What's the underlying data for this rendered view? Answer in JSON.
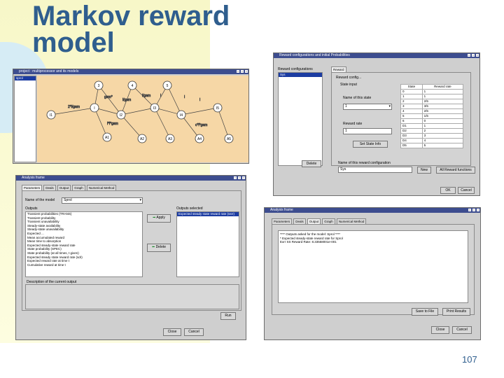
{
  "slide": {
    "title_line1": "Markov reward",
    "title_line2": "model",
    "page_number": "107"
  },
  "markov_window": {
    "title": "project : multiprocessor and its models",
    "tree_item": "sprol",
    "nodes": [
      "I1",
      "I",
      "I2",
      "I3",
      "I4",
      "I5",
      "3",
      "4",
      "5",
      "A1",
      "A2",
      "A3",
      "A4",
      "A5"
    ],
    "edge_labels": [
      "2*l/gam",
      "gam*",
      "l/gam",
      "l/gam",
      "l",
      "l",
      "l",
      "l*l*gam",
      "c*l*gam"
    ]
  },
  "reward_window": {
    "title": "Reward configurations and initial Probabilities",
    "list_header": "Reward configurations",
    "list_item": "Sys",
    "tab": "Reward",
    "group_label": "Reward config...",
    "state_label": "State input",
    "name_label": "Name of this state",
    "state_value": "1",
    "reward_rate_label": "Reward rate",
    "reward_rate_value": "1",
    "apply_button": "Set State Info",
    "table_headers": [
      "State",
      "Reward rate"
    ],
    "table_rows": [
      [
        "0",
        "1"
      ],
      [
        "1",
        "1"
      ],
      [
        "2",
        "2/5"
      ],
      [
        "3",
        "3/5"
      ],
      [
        "4",
        "2/5"
      ],
      [
        "5",
        "1/5"
      ],
      [
        "6",
        "0"
      ],
      [
        "D1",
        "1"
      ],
      [
        "D2",
        "2"
      ],
      [
        "D3",
        "3"
      ],
      [
        "D4",
        "4"
      ],
      [
        "D5",
        "5"
      ]
    ],
    "bottom_left_button": "Delete",
    "name_field_label": "Name of this reward configuration",
    "name_field_value": "Sys",
    "new_button": "New",
    "all_button": "All Reward functions",
    "ok_button": "OK",
    "cancel_button": "Cancel"
  },
  "analysis_window_1": {
    "title": "Analysis frame",
    "tabs": [
      "Parameters",
      "Deals",
      "Output",
      "Graph",
      "Numerical Method"
    ],
    "active_tab": "Parameters",
    "name_label": "Name of the model",
    "name_value": "Sprol",
    "outputs_header": "Outputs",
    "outputs": [
      "Transient probabilities (TRANS)",
      "Transient probability",
      "Transient unavailability",
      "Steady-state availability",
      "Steady-state unavailability",
      "Expected ...",
      "Mean accumulated reward",
      "Mean time to absorption",
      "Expected steady-state reward rate",
      "State probability (SPEC)",
      "State probability (at all times, t given)",
      "Expected steady state reward rate (sdr)",
      "Expected reward rate at time t",
      "Cumulative reward at time t"
    ],
    "selected_header": "Outputs selected",
    "selected_item": "Expected steady state reward rate (ssrr)",
    "apply_button": "Apply",
    "delete_button": "Delete",
    "bottom_label": "Description of the current output",
    "run_button": "Run",
    "close_button": "Close",
    "cancel_button": "Cancel"
  },
  "analysis_window_2": {
    "title": "Analysis frame",
    "tabs": [
      "Parameters",
      "Deals",
      "Output",
      "Graph",
      "Numerical Method"
    ],
    "active_tab": "Output",
    "output_lines": [
      "**** Outputs asked for the model: Sprol ****",
      "* Expected steady-state reward rate for Sprol",
      "Exrr SS Reward Rate: 8.33558001e-001"
    ],
    "save_button": "Save to File",
    "print_button": "Print Results",
    "close_button": "Close",
    "cancel_button": "Cancel"
  }
}
